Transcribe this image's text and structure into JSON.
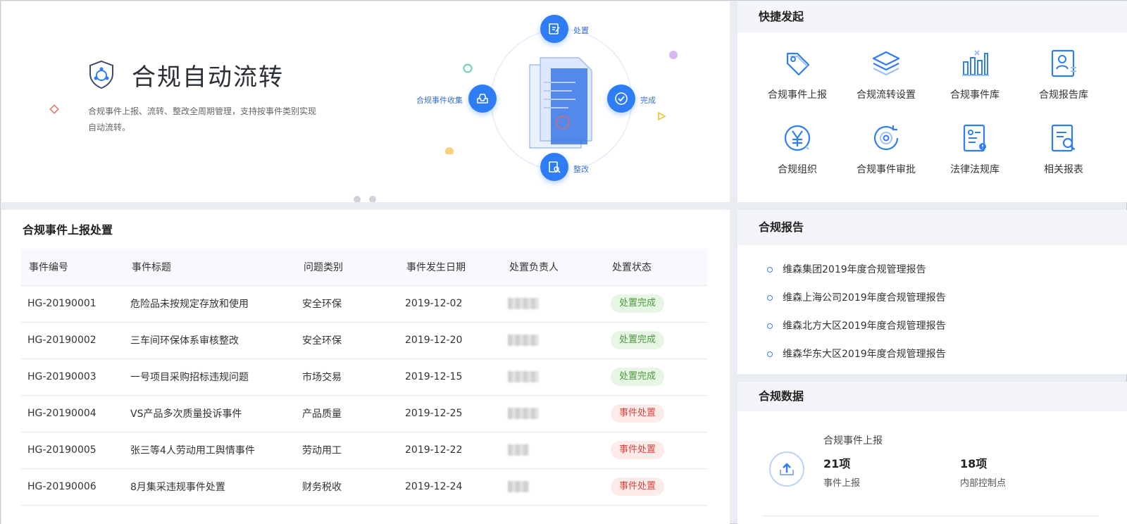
{
  "banner": {
    "title": "合规自动流转",
    "description": "合规事件上报、流转、整改全周期管理，支持按事件类别实现自动流转。",
    "steps": {
      "dispose": "处置",
      "complete": "完成",
      "rectify": "整改",
      "collect": "合规事件收集"
    }
  },
  "quick": {
    "title": "快捷发起",
    "items": [
      {
        "label": "合规事件上报",
        "icon": "tag-icon"
      },
      {
        "label": "合规流转设置",
        "icon": "layers-icon"
      },
      {
        "label": "合规事件库",
        "icon": "bar-chart-icon"
      },
      {
        "label": "合规报告库",
        "icon": "user-report-icon"
      },
      {
        "label": "合规组织",
        "icon": "yen-circle-icon"
      },
      {
        "label": "合规事件审批",
        "icon": "refresh-eye-icon"
      },
      {
        "label": "法律法规库",
        "icon": "document-badge-icon"
      },
      {
        "label": "相关报表",
        "icon": "document-search-icon"
      }
    ]
  },
  "events": {
    "title": "合规事件上报处置",
    "columns": [
      "事件编号",
      "事件标题",
      "问题类别",
      "事件发生日期",
      "处置负责人",
      "处置状态"
    ],
    "rows": [
      {
        "id": "HG-20190001",
        "title": "危险品未按规定存放和使用",
        "category": "安全环保",
        "date": "2019-12-02",
        "status": "处置完成",
        "status_type": "done"
      },
      {
        "id": "HG-20190002",
        "title": "三车间环保体系审核整改",
        "category": "安全环保",
        "date": "2019-12-20",
        "status": "处置完成",
        "status_type": "done"
      },
      {
        "id": "HG-20190003",
        "title": "一号项目采购招标违规问题",
        "category": "市场交易",
        "date": "2019-12-15",
        "status": "处置完成",
        "status_type": "done"
      },
      {
        "id": "HG-20190004",
        "title": "VS产品多次质量投诉事件",
        "category": "产品质量",
        "date": "2019-12-25",
        "status": "事件处置",
        "status_type": "proc"
      },
      {
        "id": "HG-20190005",
        "title": "张三等4人劳动用工舆情事件",
        "category": "劳动用工",
        "date": "2019-12-22",
        "status": "事件处置",
        "status_type": "proc"
      },
      {
        "id": "HG-20190006",
        "title": "8月集采违规事件处置",
        "category": "财务税收",
        "date": "2019-12-24",
        "status": "事件处置",
        "status_type": "proc"
      }
    ]
  },
  "reports": {
    "title": "合规报告",
    "items": [
      "维森集团2019年度合规管理报告",
      "维森上海公司2019年度合规管理报告",
      "维森北方大区2019年度合规管理报告",
      "维森华东大区2019年度合规管理报告"
    ]
  },
  "data_panel": {
    "title": "合规数据",
    "subtitle": "合规事件上报",
    "stats": [
      {
        "value": "21项",
        "caption": "事件上报"
      },
      {
        "value": "18项",
        "caption": "内部控制点"
      }
    ]
  },
  "colors": {
    "accent": "#2f7df6",
    "done_bg": "#e6f5e4",
    "done_fg": "#4c9a3f",
    "proc_bg": "#fdebea",
    "proc_fg": "#d9453d"
  }
}
